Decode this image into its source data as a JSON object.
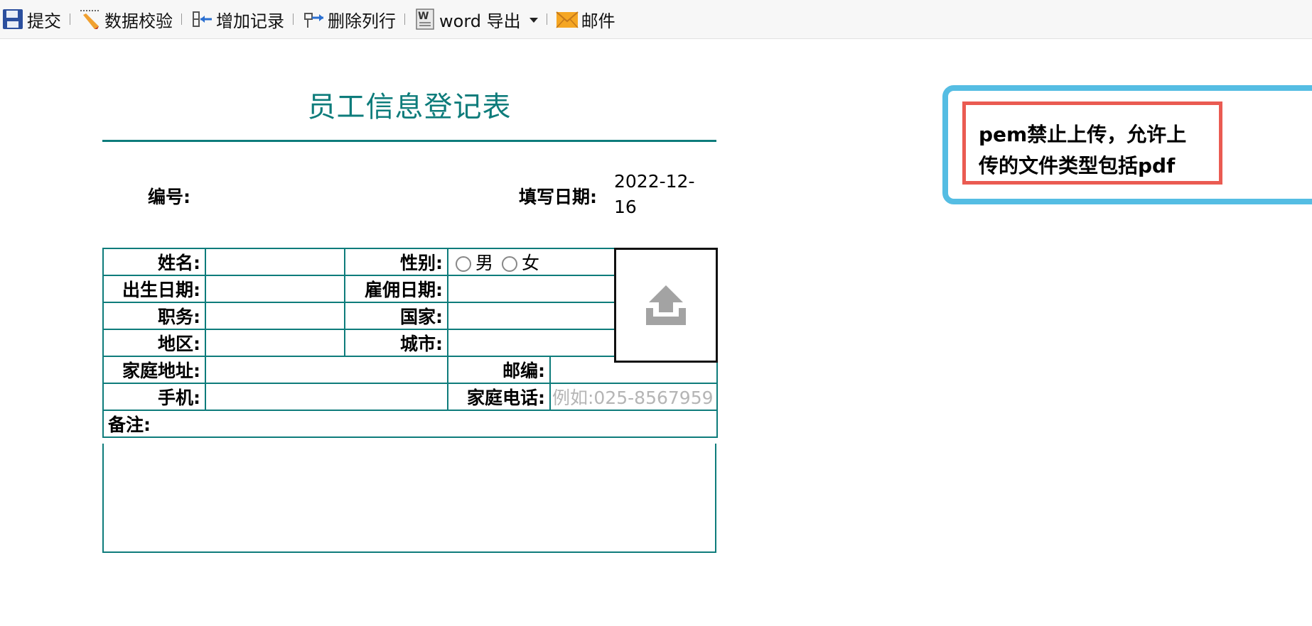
{
  "toolbar": {
    "submit": "提交",
    "validate": "数据校验",
    "add_record": "增加记录",
    "delete_row": "删除列行",
    "word_export": "word 导出",
    "mail": "邮件"
  },
  "form": {
    "title": "员工信息登记表",
    "number_label": "编号:",
    "fill_date_label": "填写日期:",
    "fill_date_value": "2022-12-\n16",
    "name_label": "姓名:",
    "gender_label": "性别:",
    "gender_male": "男",
    "gender_female": "女",
    "birth_label": "出生日期:",
    "hire_label": "雇佣日期:",
    "position_label": "职务:",
    "country_label": "国家:",
    "region_label": "地区:",
    "city_label": "城市:",
    "address_label": "家庭地址:",
    "zip_label": "邮编:",
    "mobile_label": "手机:",
    "home_phone_label": "家庭电话:",
    "home_phone_placeholder": "例如:025-8567959",
    "notes_label": "备注:"
  },
  "callout": {
    "text": "pem禁止上传，允许上\n传的文件类型包括pdf"
  },
  "colors": {
    "accent": "#0e7c7b",
    "callout_outer": "#55bde3",
    "callout_inner": "#ea5b52"
  }
}
